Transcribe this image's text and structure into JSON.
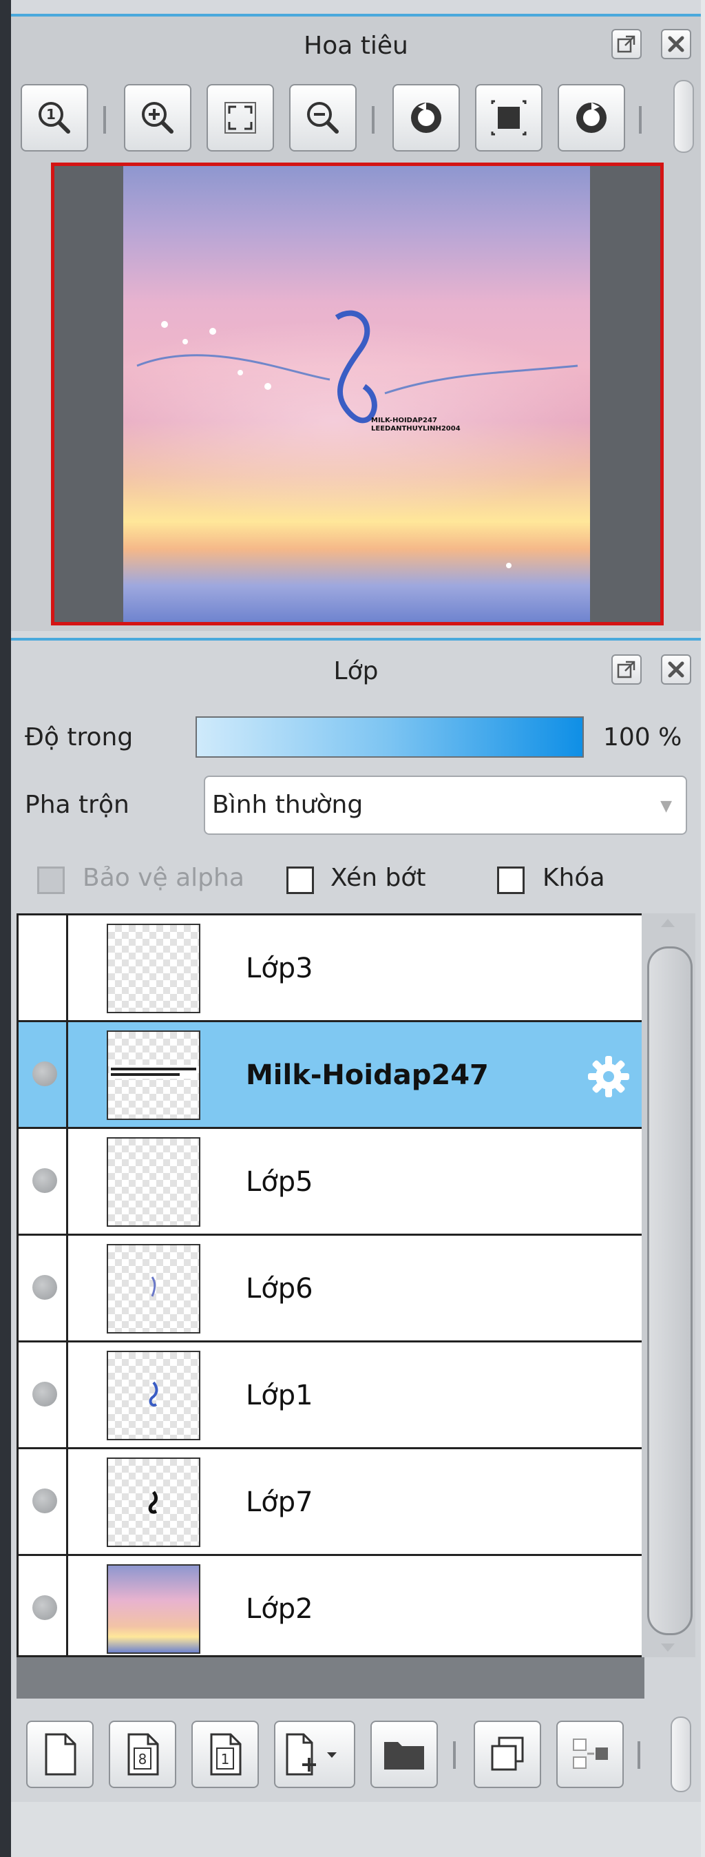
{
  "navigator": {
    "title": "Hoa tiêu",
    "toolbar": [
      "zoom-actual-icon",
      "zoom-in-icon",
      "fit-window-icon",
      "zoom-out-icon",
      "rotate-left-icon",
      "reset-view-icon",
      "rotate-right-icon"
    ],
    "preview_text_1": "MILK-HOIDAP247",
    "preview_text_2": "LEEDANTHUYLINH2004"
  },
  "layer_panel": {
    "title": "Lớp",
    "opacity_label": "Độ trong",
    "opacity_value": "100 %",
    "opacity_fraction": 1.0,
    "blend_label": "Pha trộn",
    "blend_value": "Bình thường",
    "protect_alpha_label": "Bảo vệ alpha",
    "clipping_label": "Xén bớt",
    "lock_label": "Khóa",
    "layers": [
      {
        "name": "Lớp3",
        "visible_dot": false,
        "selected": false
      },
      {
        "name": "Milk-Hoidap247",
        "visible_dot": true,
        "selected": true
      },
      {
        "name": "Lớp5",
        "visible_dot": true,
        "selected": false
      },
      {
        "name": "Lớp6",
        "visible_dot": true,
        "selected": false
      },
      {
        "name": "Lớp1",
        "visible_dot": true,
        "selected": false
      },
      {
        "name": "Lớp7",
        "visible_dot": true,
        "selected": false
      },
      {
        "name": "Lớp2",
        "visible_dot": true,
        "selected": false
      }
    ],
    "bottom_toolbar": [
      "new-layer-icon",
      "new-layer-8bit-icon",
      "new-layer-1bit-icon",
      "add-layer-dropdown-icon",
      "new-folder-icon",
      "duplicate-layer-icon",
      "merge-layer-icon"
    ]
  },
  "colors": {
    "accent_border": "#4aa9dc",
    "selected_row": "#7fc8f2",
    "preview_frame": "#d41414"
  }
}
